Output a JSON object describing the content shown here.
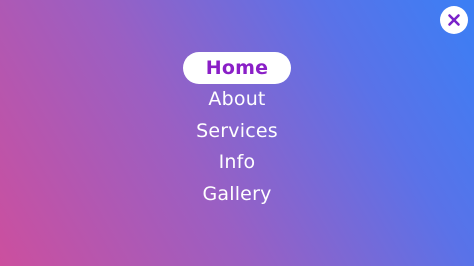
{
  "close_button": {
    "icon": "close-icon",
    "icon_color": "#7a22c9"
  },
  "menu": {
    "items": [
      {
        "label": "Home",
        "active": true
      },
      {
        "label": "About",
        "active": false
      },
      {
        "label": "Services",
        "active": false
      },
      {
        "label": "Info",
        "active": false
      },
      {
        "label": "Gallery",
        "active": false
      }
    ]
  },
  "colors": {
    "gradient_start": "#cc4f9e",
    "gradient_end": "#3a7ff5",
    "active_text": "#8a1fc7",
    "text": "#ffffff"
  }
}
